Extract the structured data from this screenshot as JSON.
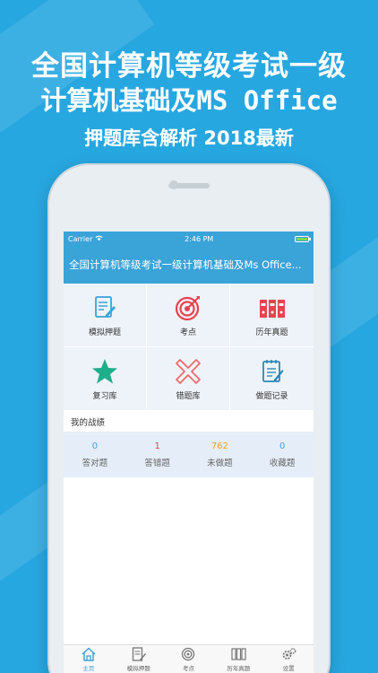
{
  "promo": {
    "line1": "全国计算机等级考试一级",
    "line2": "计算机基础及MS Office",
    "line3": "押题库含解析 2018最新"
  },
  "status_bar": {
    "carrier": "Carrier",
    "time": "2:46 PM",
    "battery_level": 1.0
  },
  "nav": {
    "title": "全国计算机等级考试一级计算机基础及Ms Office..."
  },
  "menu": [
    {
      "label": "模拟押题",
      "icon": "document-edit-icon"
    },
    {
      "label": "考点",
      "icon": "target-icon"
    },
    {
      "label": "历年真题",
      "icon": "binders-icon"
    },
    {
      "label": "复习库",
      "icon": "star-icon"
    },
    {
      "label": "错题库",
      "icon": "cross-icon"
    },
    {
      "label": "做题记录",
      "icon": "notepad-icon"
    }
  ],
  "record": {
    "title": "我的战绩",
    "stats": [
      {
        "value": "0",
        "label": "答对题",
        "color": "#3aa3d8"
      },
      {
        "value": "1",
        "label": "答错题",
        "color": "#e8424f"
      },
      {
        "value": "762",
        "label": "未做题",
        "color": "#f0a020"
      },
      {
        "value": "0",
        "label": "收藏题",
        "color": "#3aa3d8"
      }
    ]
  },
  "tabs": [
    {
      "label": "主页",
      "icon": "home-icon",
      "active": true
    },
    {
      "label": "模拟押题",
      "icon": "document-edit-icon",
      "active": false
    },
    {
      "label": "考点",
      "icon": "target-icon",
      "active": false
    },
    {
      "label": "历年真题",
      "icon": "binders-icon",
      "active": false
    },
    {
      "label": "设置",
      "icon": "gear-icon",
      "active": false
    }
  ],
  "colors": {
    "background": "#27a7e0",
    "nav": "#3aa3d8",
    "accent_red": "#e8424f",
    "star_green": "#1fae8a"
  }
}
